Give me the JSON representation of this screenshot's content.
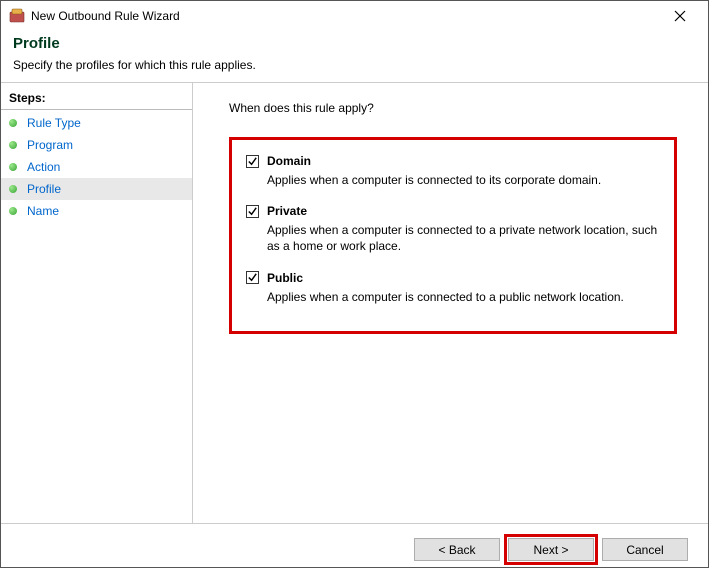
{
  "window": {
    "title": "New Outbound Rule Wizard"
  },
  "header": {
    "title": "Profile",
    "subtitle": "Specify the profiles for which this rule applies."
  },
  "sidebar": {
    "title": "Steps:",
    "items": [
      {
        "label": "Rule Type"
      },
      {
        "label": "Program"
      },
      {
        "label": "Action"
      },
      {
        "label": "Profile"
      },
      {
        "label": "Name"
      }
    ]
  },
  "content": {
    "question": "When does this rule apply?",
    "profiles": [
      {
        "label": "Domain",
        "desc": "Applies when a computer is connected to its corporate domain.",
        "checked": true
      },
      {
        "label": "Private",
        "desc": "Applies when a computer is connected to a private network location, such as a home or work place.",
        "checked": true
      },
      {
        "label": "Public",
        "desc": "Applies when a computer is connected to a public network location.",
        "checked": true
      }
    ]
  },
  "footer": {
    "back": "< Back",
    "next": "Next >",
    "cancel": "Cancel"
  }
}
